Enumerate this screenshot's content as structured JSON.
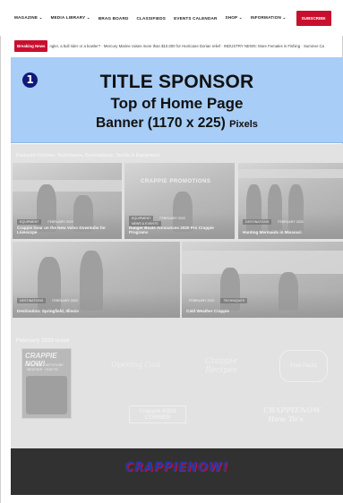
{
  "nav": {
    "items": [
      "MAGAZINE ⌄",
      "MEDIA LIBRARY ⌄",
      "BRAG BOARD",
      "CLASSIFIEDS",
      "EVENTS CALENDAR",
      "SHOP ⌄",
      "INFORMATION ⌄"
    ],
    "subscribe_label": "SUBSCRIBE"
  },
  "ticker": {
    "label": "Breaking News",
    "text": "ngler, a bull rider or a bowler? · Mercury Marine raises more than $10,000 for Hurricane Dorian relief · INDUSTRY NEWS: More Females in Fishing · Summer Ca"
  },
  "sponsor": {
    "badge": "1",
    "line1": "TITLE SPONSOR",
    "line2": "Top of Home Page",
    "line3": "Banner (1170 x 225)",
    "line3_suffix": "Pixels"
  },
  "featured": {
    "heading": "Featured Articles: Techniques, Destinations, Tackle & Equipment",
    "cards": [
      {
        "tags": [
          "EQUIPMENT",
          "FEBRUARY 2020"
        ],
        "title": "Crappie Gear on the New Volvo Downtube for Livescope"
      },
      {
        "promo": "CRAPPIE PROMOTIONS",
        "tags": [
          "EQUIPMENT",
          "FEBRUARY 2020",
          "NEWS & EVENTS"
        ],
        "title": "Ranger Boats Announces 2020 Pro Crappie Programs"
      },
      {
        "tags": [
          "DESTINATIONS",
          "FEBRUARY 2020"
        ],
        "title": "Hunting Mermaids in Missouri"
      },
      {
        "tags": [
          "DESTINATIONS",
          "FEBRUARY 2020"
        ],
        "title": "Destination: Springfield, Illinois"
      },
      {
        "tags": [
          "FEBRUARY 2020",
          "TECHNIQUES"
        ],
        "title": "Cold Weather Crappie"
      }
    ]
  },
  "issue": {
    "heading": "February 2020 Issue",
    "cover_title": "CRAPPIE NOW!",
    "cover_sub": "PLOTTING THE FUTURE · WEATHER · HOW TO",
    "tiles": [
      "Opening Cast",
      "Crappie Recipes",
      "Fish Facts",
      "Crappie KIDS CORNER",
      "CRAPPIENOW How To's"
    ]
  },
  "footer": {
    "logo": "CRAPPIENOW!"
  }
}
